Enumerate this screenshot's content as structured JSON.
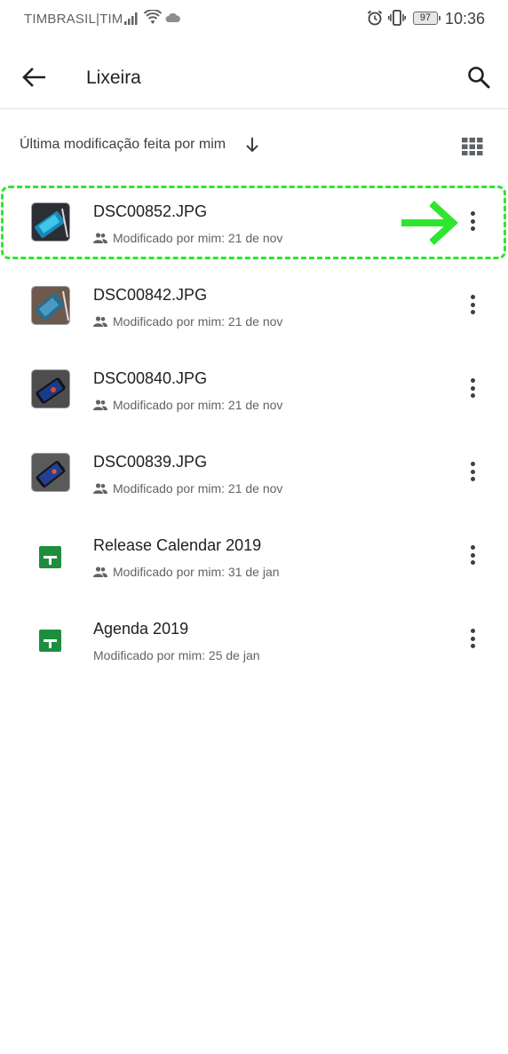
{
  "status_bar": {
    "carrier": "TIMBRASIL|TIM",
    "battery": "97",
    "time": "10:36",
    "icons": [
      "signal-icon",
      "wifi-icon",
      "cloud-icon",
      "alarm-icon",
      "vibrate-icon",
      "battery-icon"
    ]
  },
  "app_bar": {
    "title": "Lixeira",
    "back_icon": "arrow-back-icon",
    "search_icon": "search-icon"
  },
  "sort": {
    "label": "Última modificação feita por mim",
    "direction_icon": "arrow-down-icon",
    "view_icon": "grid-view-icon"
  },
  "files": [
    {
      "name": "DSC00852.JPG",
      "meta": "Modificado por mim: 21 de nov",
      "type": "image",
      "shared": true
    },
    {
      "name": "DSC00842.JPG",
      "meta": "Modificado por mim: 21 de nov",
      "type": "image",
      "shared": true
    },
    {
      "name": "DSC00840.JPG",
      "meta": "Modificado por mim: 21 de nov",
      "type": "image",
      "shared": true
    },
    {
      "name": "DSC00839.JPG",
      "meta": "Modificado por mim: 21 de nov",
      "type": "image",
      "shared": true
    },
    {
      "name": "Release Calendar 2019",
      "meta": "Modificado por mim: 31 de jan",
      "type": "sheets",
      "shared": true
    },
    {
      "name": "Agenda 2019",
      "meta": "Modificado por mim: 25 de jan",
      "type": "sheets",
      "shared": false
    }
  ],
  "colors": {
    "highlight": "#2ee62e",
    "sheets_green": "#1e8e3e",
    "text_primary": "#202124",
    "text_secondary": "#5f6368"
  }
}
